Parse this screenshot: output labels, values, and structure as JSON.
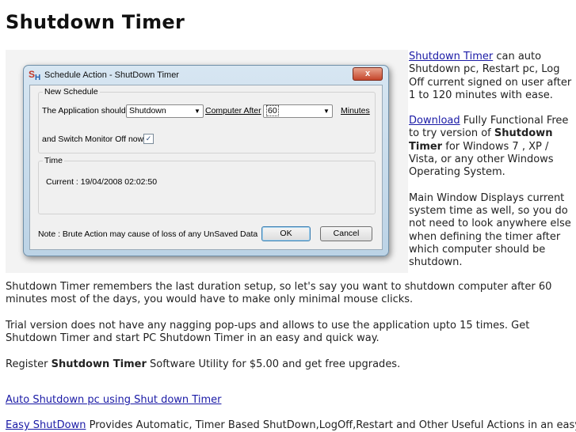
{
  "page": {
    "title": "Shutdown Timer"
  },
  "dialog": {
    "logo_s": "S",
    "logo_h": "H",
    "title": "Schedule Action - ShutDown Timer",
    "close_label": "x",
    "new_schedule_legend": "New Schedule",
    "app_should_label": "The Application should",
    "action_value": "Shutdown",
    "computer_after_label": "Computer After",
    "minutes_value": "60",
    "minutes_label": "Minutes",
    "monitor_label": "and Switch Monitor Off now",
    "monitor_checked": "✓",
    "time_legend": "Time",
    "current_time": "Current : 19/04/2008 02:02:50",
    "note": "Note : Brute Action may cause of loss of any UnSaved Data",
    "ok_label": "OK",
    "cancel_label": "Cancel"
  },
  "side": {
    "p1_link": "Shutdown Timer",
    "p1_text": " can auto Shutdown pc, Restart pc, Log Off current signed on user after 1 to 120 minutes with ease.",
    "p2_link": "Download",
    "p2_text1": " Fully Functional Free to try version of ",
    "p2_bold": "Shutdown Timer",
    "p2_text2": " for Windows 7 , XP / Vista, or any other Windows Operating System.",
    "p3_text": "Main Window Displays current system time as well, so you do not need to look anywhere else when defining the timer after which computer should be shutdown."
  },
  "content": {
    "para1": "Shutdown Timer remembers the last duration setup, so let's say you want to shutdown computer after 60 minutes most of the days, you would have to make only minimal mouse clicks.",
    "para2": "Trial version does not have any nagging pop-ups and allows to use the application upto 15 times. Get Shutdown Timer and start PC Shutdown Timer in an easy and quick way.",
    "para3_pre": "Register ",
    "para3_bold": "Shutdown Timer",
    "para3_post": " Software Utility for $5.00 and get free upgrades.",
    "link1": "Auto Shutdown pc using Shut down Timer",
    "link2": "Easy ShutDown",
    "link2_text": " Provides Automatic, Timer Based ShutDown,LogOff,Restart and Other Useful Actions in an easy"
  }
}
